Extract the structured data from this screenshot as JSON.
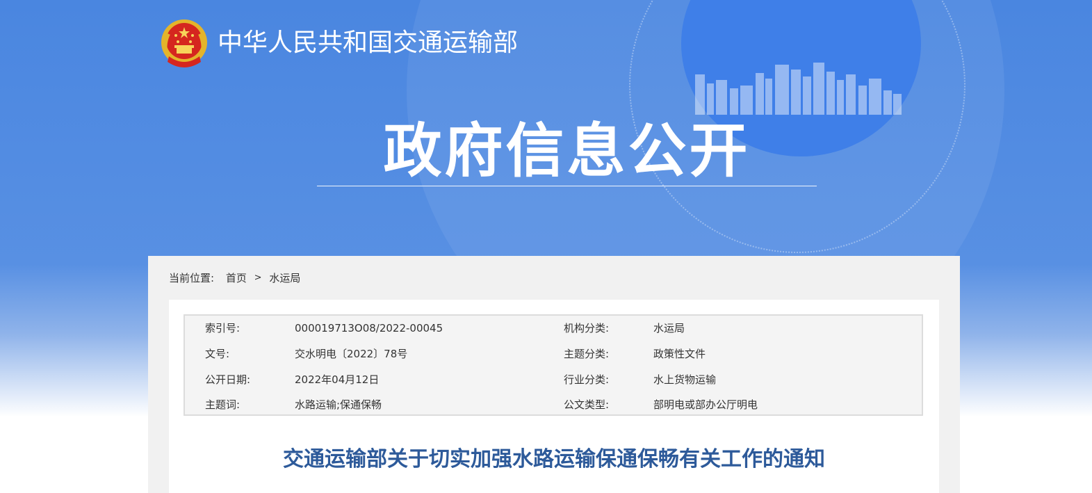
{
  "header": {
    "ministry_name": "中华人民共和国交通运输部",
    "banner_title": "政府信息公开"
  },
  "breadcrumb": {
    "prefix": "当前位置:",
    "home": "首页",
    "separator": ">",
    "current": "水运局"
  },
  "metadata": [
    {
      "label1": "索引号:",
      "value1": "000019713O08/2022-00045",
      "label2": "机构分类:",
      "value2": "水运局"
    },
    {
      "label1": "文号:",
      "value1": "交水明电〔2022〕78号",
      "label2": "主题分类:",
      "value2": "政策性文件"
    },
    {
      "label1": "公开日期:",
      "value1": "2022年04月12日",
      "label2": "行业分类:",
      "value2": "水上货物运输"
    },
    {
      "label1": "主题词:",
      "value1": "水路运输;保通保畅",
      "label2": "公文类型:",
      "value2": "部明电或部办公厅明电"
    }
  ],
  "article": {
    "title": "交通运输部关于切实加强水路运输保通保畅有关工作的通知"
  },
  "colors": {
    "banner_blue": "#4a86e0",
    "title_blue": "#2d5a9a",
    "panel_gray": "#f1f1f1"
  },
  "icons": {
    "logo": "national-emblem-icon"
  }
}
